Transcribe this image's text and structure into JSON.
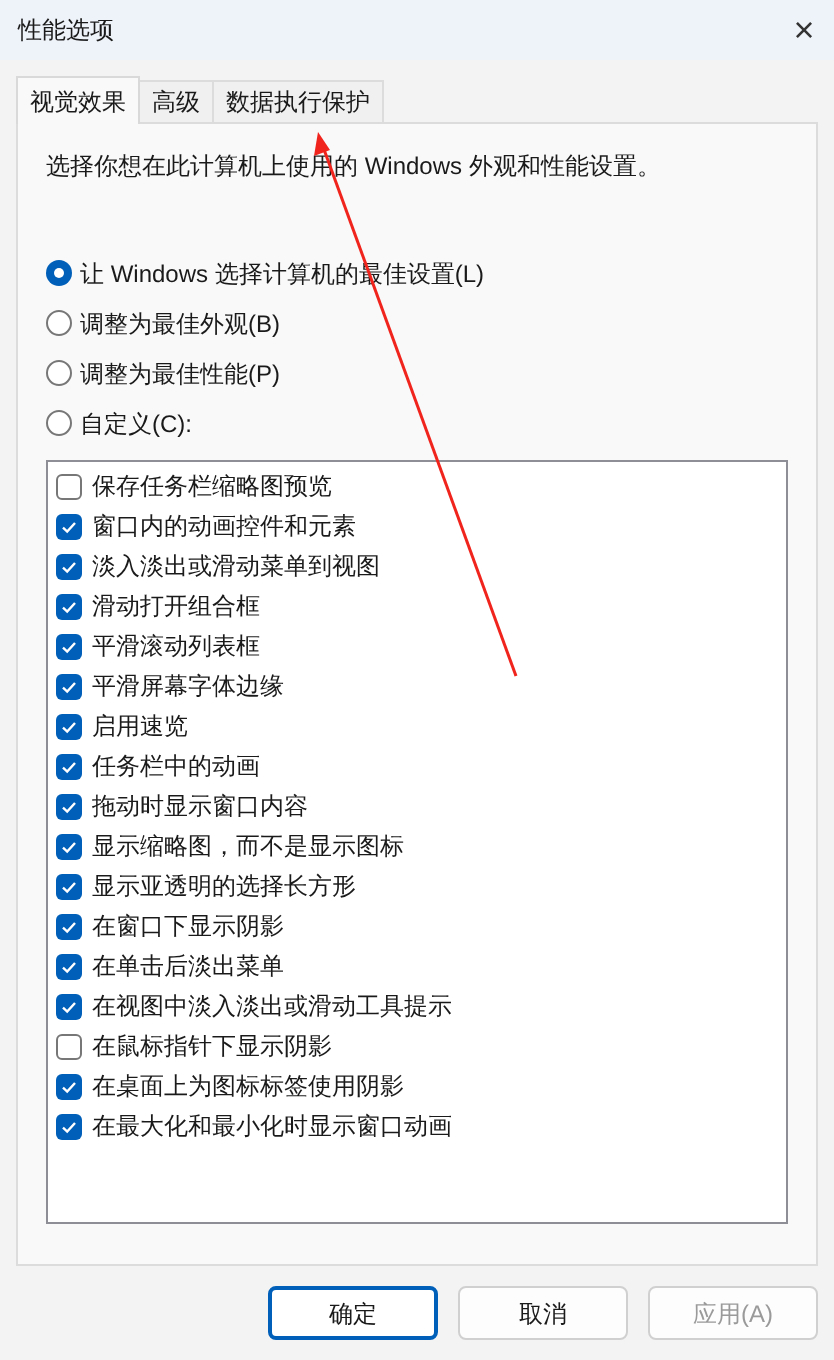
{
  "window": {
    "title": "性能选项",
    "close": "×"
  },
  "tabs": [
    {
      "label": "视觉效果",
      "selected": true
    },
    {
      "label": "高级",
      "selected": false
    },
    {
      "label": "数据执行保护",
      "selected": false
    }
  ],
  "intro": "选择你想在此计算机上使用的 Windows 外观和性能设置。",
  "options": [
    {
      "label": "让 Windows 选择计算机的最佳设置(L)",
      "selected": true
    },
    {
      "label": "调整为最佳外观(B)",
      "selected": false
    },
    {
      "label": "调整为最佳性能(P)",
      "selected": false
    },
    {
      "label": "自定义(C):",
      "selected": false
    }
  ],
  "effects": [
    {
      "label": "保存任务栏缩略图预览",
      "checked": false
    },
    {
      "label": "窗口内的动画控件和元素",
      "checked": true
    },
    {
      "label": "淡入淡出或滑动菜单到视图",
      "checked": true
    },
    {
      "label": "滑动打开组合框",
      "checked": true
    },
    {
      "label": "平滑滚动列表框",
      "checked": true
    },
    {
      "label": "平滑屏幕字体边缘",
      "checked": true
    },
    {
      "label": "启用速览",
      "checked": true
    },
    {
      "label": "任务栏中的动画",
      "checked": true
    },
    {
      "label": "拖动时显示窗口内容",
      "checked": true
    },
    {
      "label": "显示缩略图，而不是显示图标",
      "checked": true
    },
    {
      "label": "显示亚透明的选择长方形",
      "checked": true
    },
    {
      "label": "在窗口下显示阴影",
      "checked": true
    },
    {
      "label": "在单击后淡出菜单",
      "checked": true
    },
    {
      "label": "在视图中淡入淡出或滑动工具提示",
      "checked": true
    },
    {
      "label": "在鼠标指针下显示阴影",
      "checked": false
    },
    {
      "label": "在桌面上为图标标签使用阴影",
      "checked": true
    },
    {
      "label": "在最大化和最小化时显示窗口动画",
      "checked": true
    }
  ],
  "buttons": [
    {
      "label": "确定",
      "default": true,
      "disabled": false
    },
    {
      "label": "取消",
      "default": false,
      "disabled": false
    },
    {
      "label": "应用(A)",
      "default": false,
      "disabled": true
    }
  ]
}
